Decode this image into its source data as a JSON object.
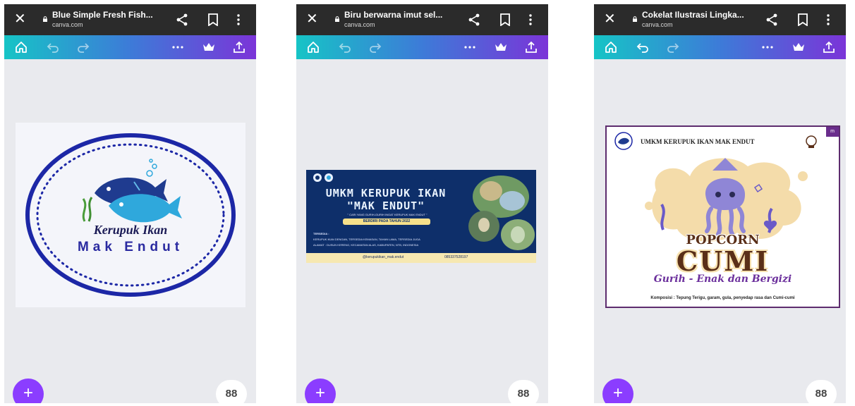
{
  "colors": {
    "browser_bar": "#2b2b2b",
    "toolbar_gradient": [
      "#16c4c6",
      "#3d7bd8",
      "#7b34d8"
    ],
    "canvas_bg": "#e9eaee",
    "fab_purple": "#8b3dff"
  },
  "toolbar_icons": [
    "home-icon",
    "undo-icon",
    "redo-icon",
    "more-dots-icon",
    "crown-icon",
    "upload-icon"
  ],
  "phones": [
    {
      "tab_title": "Blue Simple Fresh Fish...",
      "domain": "canva.com",
      "design": {
        "line1": "Kerupuk Ikan",
        "line2": "Mak Endut"
      }
    },
    {
      "tab_title": "Biru berwarna imut sel...",
      "domain": "canva.com",
      "design": {
        "title1": "UMKM KERUPUK IKAN",
        "title2": "\"MAK ENDUT\"",
        "tagline": "\" CARI YANG GURIH-GURIH INGAT KERUPUK MAK ENDUT \"",
        "since": "BERDIRI PADA TAHUN 2022",
        "info_label": "TERSEDIA :",
        "info_line1": "KERUPUK IKAN DENGAN, TERSEDIA KEMASAN, TAHAN LAMA, TERSEDIA JUGA",
        "info_line2": "ALAMAT : DUSUN KERENG, KECAMATAN ALAS, KABUPATEN, NTB, INDONESIA",
        "social_handle": "@kerupukikan_mak.endut",
        "phone_number": "085337528197"
      }
    },
    {
      "tab_title": "Cokelat Ilustrasi Lingka...",
      "domain": "canva.com",
      "design": {
        "header": "UMKM KERUPUK IKAN MAK ENDUT",
        "badge": "m",
        "line1": "POPCORN",
        "line2": "CUMI",
        "tagline": "Gurih - Enak dan Bergizi",
        "composition": "Komposisi : Tepung Terigu, garam, gula, penyedap rasa dan Cumi-cumi"
      }
    }
  ],
  "fab_add_label": "+",
  "fab_pages_label": "88"
}
